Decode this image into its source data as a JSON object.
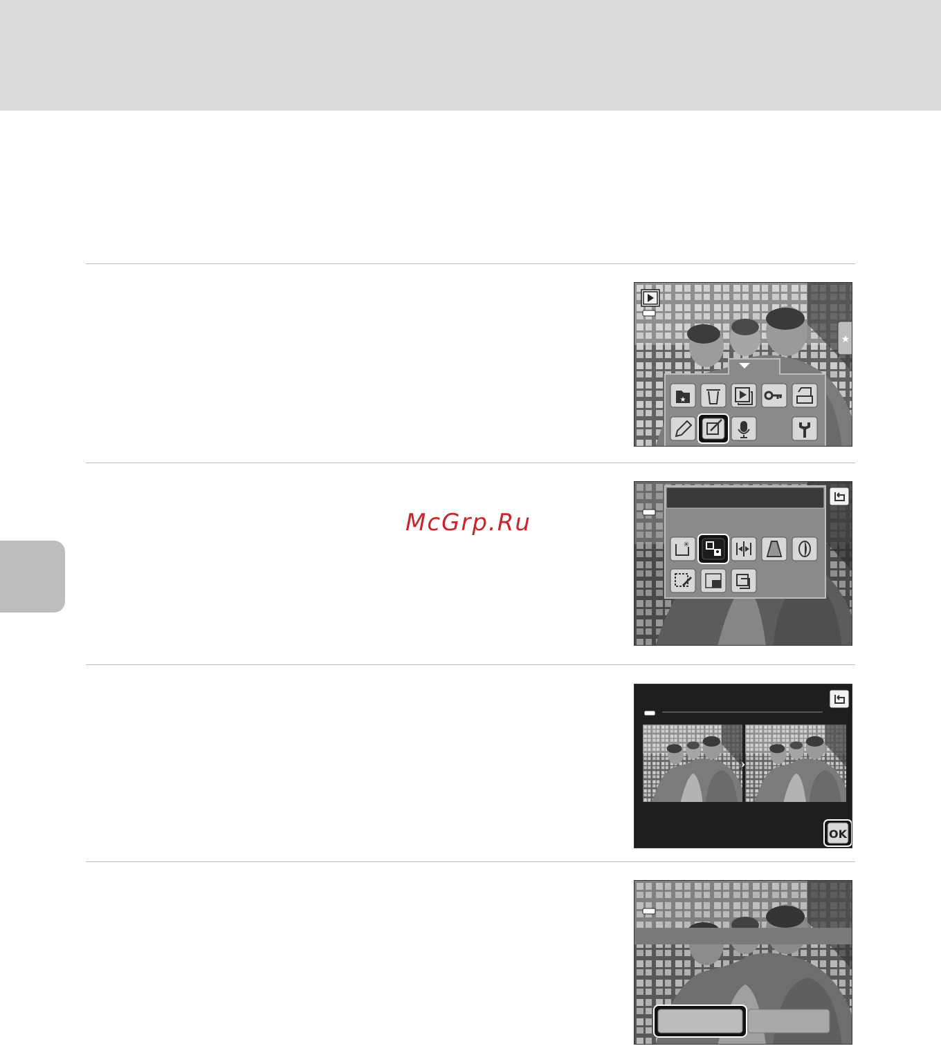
{
  "watermark": "McGrp.Ru",
  "screens": {
    "playback_menu": {
      "mode_icon": "play-icon",
      "side_tab_icon": "star-icon",
      "row1_icons": [
        "favorites-folder-icon",
        "trash-icon",
        "slideshow-icon",
        "protect-key-icon",
        "print-order-icon"
      ],
      "row2_icons": [
        "retouch-pencil-icon",
        "edit-icon",
        "voice-memo-icon",
        "setup-wrench-icon"
      ],
      "selected_icon": "edit-icon"
    },
    "edit_menu": {
      "back_icon": "back-icon",
      "row1_icons": [
        "quick-retouch-icon",
        "glamour-retouch-icon",
        "d-lighting-icon",
        "perspective-icon",
        "skin-softening-icon"
      ],
      "row2_icons": [
        "filter-effects-icon",
        "small-picture-icon",
        "crop-icon"
      ],
      "selected_icon": "glamour-retouch-icon"
    },
    "preview": {
      "back_icon": "back-icon",
      "ok_label": "OK"
    },
    "confirm": {
      "left_button_label": "",
      "right_button_label": ""
    }
  }
}
